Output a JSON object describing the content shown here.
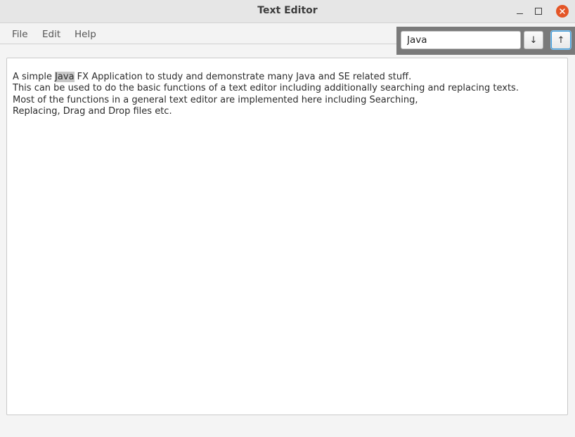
{
  "window": {
    "title": "Text Editor"
  },
  "menu": {
    "items": [
      "File",
      "Edit",
      "Help"
    ]
  },
  "search": {
    "value": "Java",
    "find_next_label": "↓",
    "find_prev_label": "↑"
  },
  "editor": {
    "line1_before": "A simple ",
    "line1_match": "Java",
    "line1_after": " FX Application to study and demonstrate many Java and SE related stuff.",
    "line2": "This can be used to do the basic functions of a text editor including additionally searching and replacing texts.",
    "line3": "Most of the functions in a general text editor are implemented here including Searching,",
    "line4": "Replacing, Drag and Drop files etc."
  },
  "colors": {
    "close_button": "#e45526",
    "search_panel": "#7a7a7a",
    "highlight": "#c8c8c8",
    "focus_ring": "#3c9ad9"
  }
}
